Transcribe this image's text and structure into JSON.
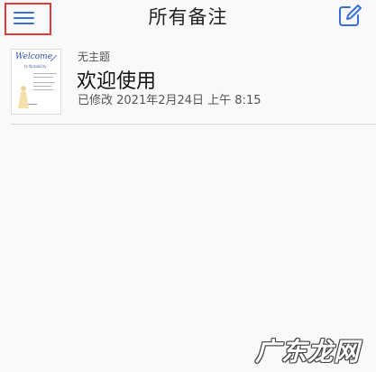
{
  "header": {
    "title": "所有备注",
    "menu_icon": "hamburger-menu-icon",
    "compose_icon": "compose-edit-icon",
    "accent_color": "#3a6fd8",
    "highlight_color": "#e53935"
  },
  "notes": [
    {
      "category": "无主题",
      "title": "欢迎使用",
      "modified": "已修改 2021年2月24日 上午 8:15",
      "thumbnail": {
        "heading": "Welcome",
        "subheading": "to Notability"
      }
    }
  ],
  "watermark": "广东龙网"
}
